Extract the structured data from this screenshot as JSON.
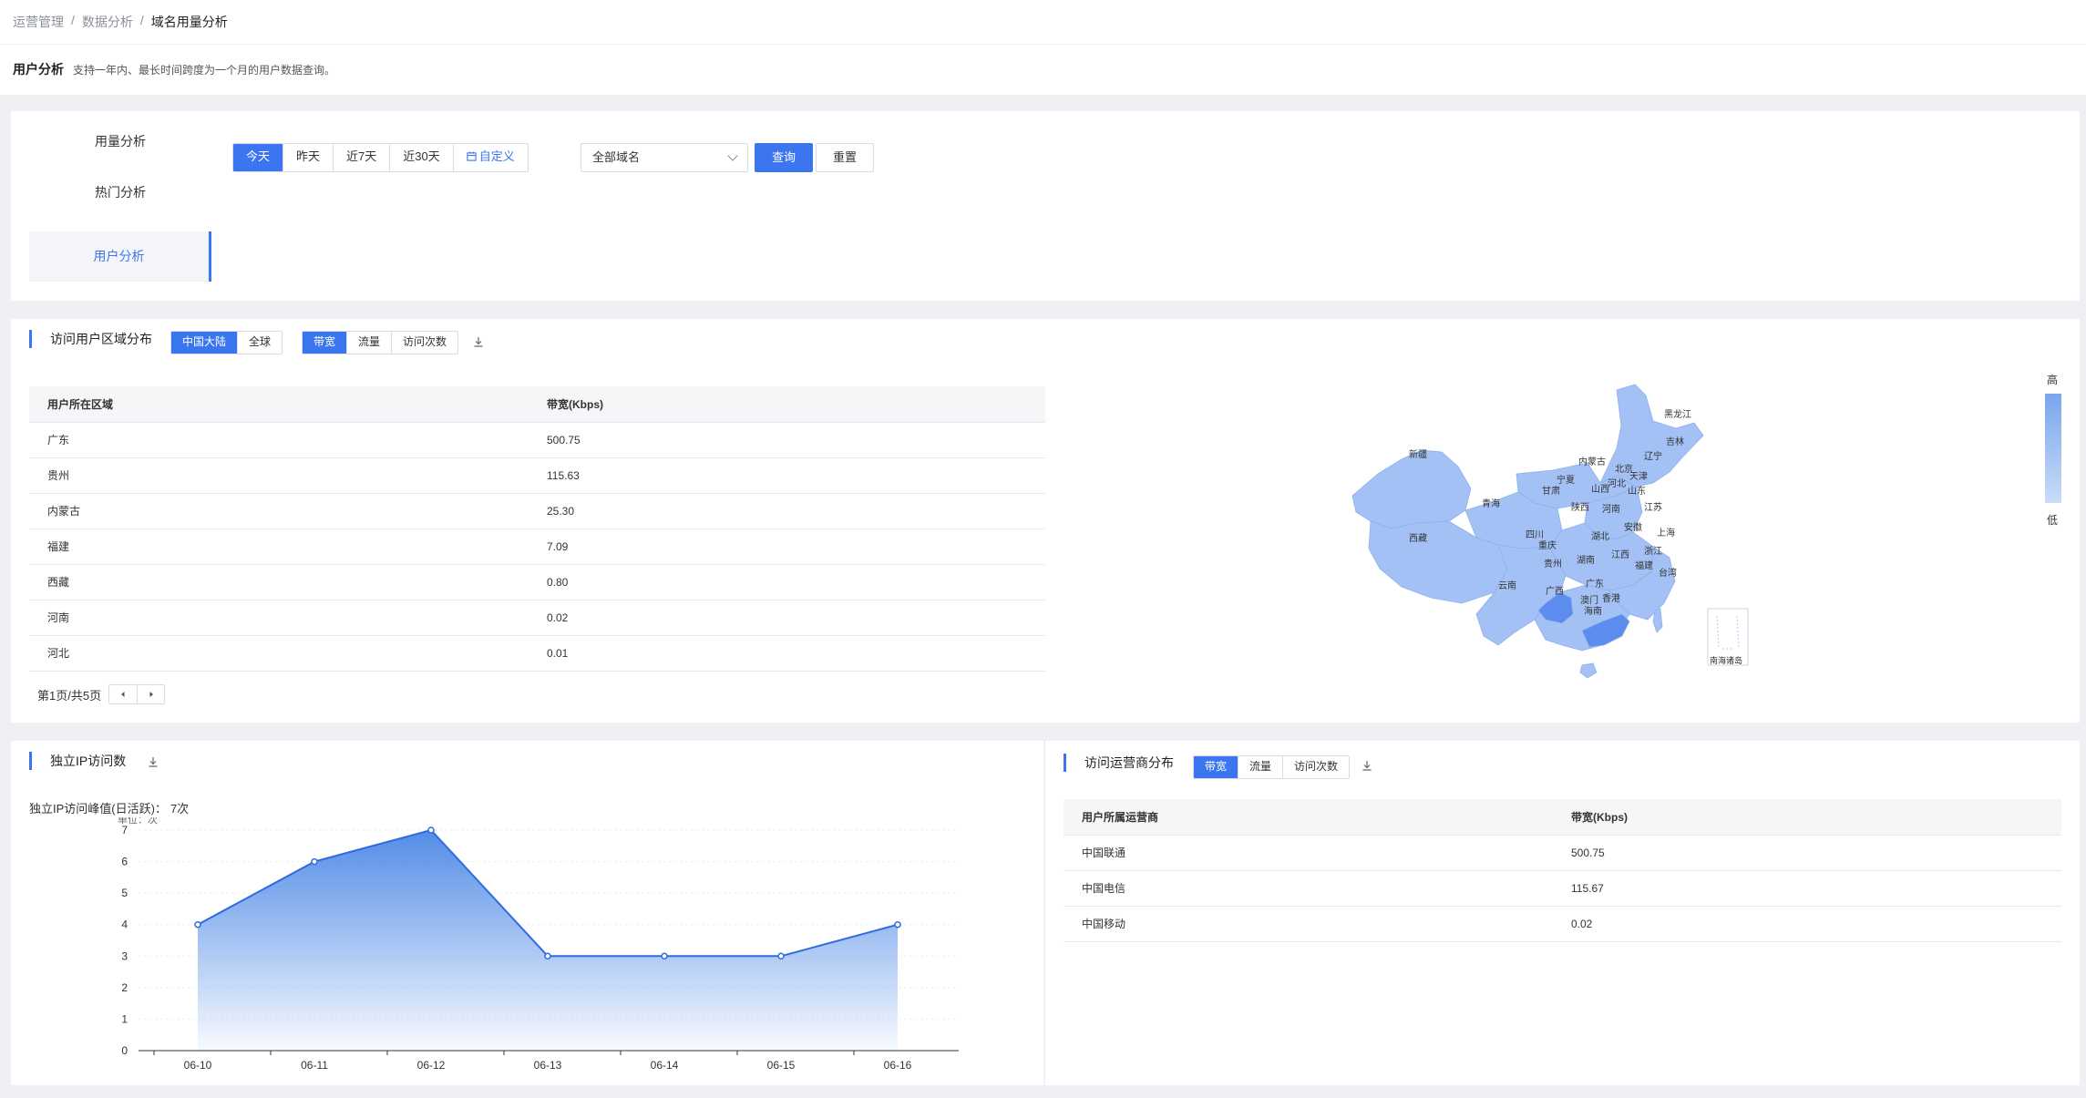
{
  "breadcrumb": [
    "运营管理",
    "数据分析",
    "域名用量分析"
  ],
  "header": {
    "title": "用户分析",
    "desc": "支持一年内、最长时间跨度为一个月的用户数据查询。"
  },
  "sidetabs": [
    {
      "label": "用量分析",
      "active": false
    },
    {
      "label": "热门分析",
      "active": false
    },
    {
      "label": "用户分析",
      "active": true
    }
  ],
  "filters": {
    "ranges": [
      "今天",
      "昨天",
      "近7天",
      "近30天"
    ],
    "custom": "自定义",
    "domain_select": "全部域名",
    "query": "查询",
    "reset": "重置"
  },
  "region": {
    "title": "访问用户区域分布",
    "scope": [
      "中国大陆",
      "全球"
    ],
    "metrics": [
      "带宽",
      "流量",
      "访问次数"
    ],
    "columns": [
      "用户所在区域",
      "带宽(Kbps)"
    ],
    "rows": [
      [
        "广东",
        "500.75"
      ],
      [
        "贵州",
        "115.63"
      ],
      [
        "内蒙古",
        "25.30"
      ],
      [
        "福建",
        "7.09"
      ],
      [
        "西藏",
        "0.80"
      ],
      [
        "河南",
        "0.02"
      ],
      [
        "河北",
        "0.01"
      ]
    ],
    "pager": "第1页/共5页",
    "legend_high": "高",
    "legend_low": "低",
    "map_labels": {
      "heilongjiang": "黑龙江",
      "jilin": "吉林",
      "liaoning": "辽宁",
      "neimenggu": "内蒙古",
      "beijing": "北京",
      "tianjin": "天津",
      "hebei": "河北",
      "shanxi": "山西",
      "shandong": "山东",
      "xinjiang": "新疆",
      "ningxia": "宁夏",
      "gansu": "甘肃",
      "qinghai": "青海",
      "shaanxi": "陕西",
      "henan": "河南",
      "jiangsu": "江苏",
      "anhui": "安徽",
      "shanghai": "上海",
      "xizang": "西藏",
      "sichuan": "四川",
      "hubei": "湖北",
      "chongqing": "重庆",
      "zhejiang": "浙江",
      "jiangxi": "江西",
      "hunan": "湖南",
      "guizhou": "贵州",
      "fujian": "福建",
      "taiwan": "台湾",
      "yunnan": "云南",
      "guangxi": "广西",
      "guangdong": "广东",
      "aomen": "澳门",
      "xianggang": "香港",
      "hainan": "海南",
      "nanhai": "南海诸岛"
    },
    "colors": {
      "base": "#a4c1f5",
      "mid": "#7aa5ee",
      "strong": "#5b8cee"
    }
  },
  "ip": {
    "title": "独立IP访问数",
    "peak_label": "独立IP访问峰值(日活跃)：",
    "peak_value": "7次",
    "chart_data": {
      "type": "area",
      "categories": [
        "06-10",
        "06-11",
        "06-12",
        "06-13",
        "06-14",
        "06-15",
        "06-16"
      ],
      "values": [
        4,
        6,
        7,
        3,
        3,
        3,
        4
      ],
      "ylabel": "单位：次",
      "ylim": [
        0,
        7
      ],
      "yticks": [
        0,
        1,
        2,
        3,
        4,
        5,
        6,
        7
      ],
      "color": "#2e6be0"
    }
  },
  "isp": {
    "title": "访问运营商分布",
    "metrics": [
      "带宽",
      "流量",
      "访问次数"
    ],
    "columns": [
      "用户所属运营商",
      "带宽(Kbps)"
    ],
    "rows": [
      [
        "中国联通",
        "500.75"
      ],
      [
        "中国电信",
        "115.67"
      ],
      [
        "中国移动",
        "0.02"
      ]
    ]
  }
}
